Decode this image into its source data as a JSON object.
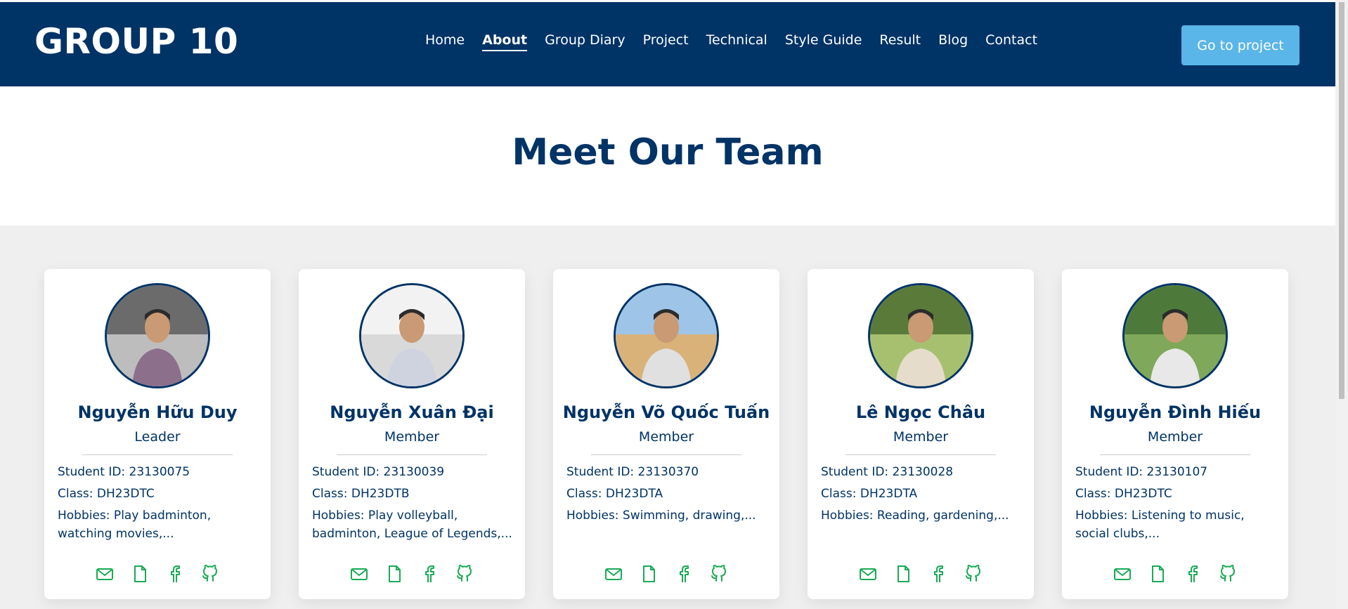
{
  "header": {
    "logo": "GROUP 10",
    "nav": [
      {
        "label": "Home"
      },
      {
        "label": "About",
        "active": true
      },
      {
        "label": "Group Diary"
      },
      {
        "label": "Project"
      },
      {
        "label": "Technical"
      },
      {
        "label": "Style Guide"
      },
      {
        "label": "Result"
      },
      {
        "label": "Blog"
      },
      {
        "label": "Contact"
      }
    ],
    "cta_label": "Go to project"
  },
  "hero": {
    "title": "Meet Our Team"
  },
  "team": [
    {
      "name": "Nguyễn Hữu Duy",
      "role": "Leader",
      "student_id": "Student ID: 23130075",
      "class": "Class: DH23DTC",
      "hobbies": "Hobbies: Play badminton, watching movies,..."
    },
    {
      "name": "Nguyễn Xuân Đại",
      "role": "Member",
      "student_id": "Student ID: 23130039",
      "class": "Class: DH23DTB",
      "hobbies": "Hobbies: Play volleyball, badminton, League of Legends,..."
    },
    {
      "name": "Nguyễn Võ Quốc Tuấn",
      "role": "Member",
      "student_id": "Student ID: 23130370",
      "class": "Class: DH23DTA",
      "hobbies": "Hobbies: Swimming, drawing,..."
    },
    {
      "name": "Lê Ngọc Châu",
      "role": "Member",
      "student_id": "Student ID: 23130028",
      "class": "Class: DH23DTA",
      "hobbies": "Hobbies: Reading, gardening,..."
    },
    {
      "name": "Nguyễn Đình Hiếu",
      "role": "Member",
      "student_id": "Student ID: 23130107",
      "class": "Class: DH23DTC",
      "hobbies": "Hobbies: Listening to music, social clubs,..."
    }
  ],
  "social_icons": [
    "mail-icon",
    "document-icon",
    "facebook-icon",
    "github-icon"
  ],
  "colors": {
    "brand_navy": "#003366",
    "cta_blue": "#5ab5e8",
    "icon_green": "#1aaa55",
    "section_gray": "#efefef"
  }
}
